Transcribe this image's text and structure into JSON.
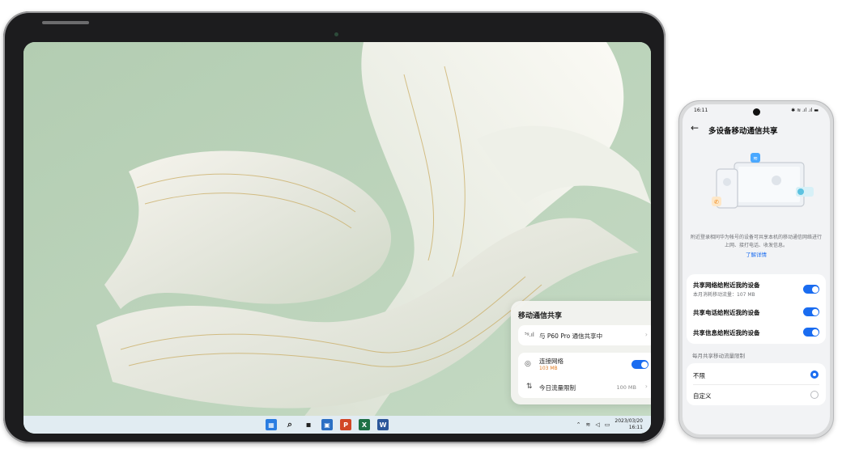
{
  "tablet": {
    "panel": {
      "title": "移动通信共享",
      "sharing_row": {
        "icon": "signal-icon",
        "label": "与 P60 Pro 通信共享中"
      },
      "connect_row": {
        "icon": "hotspot-icon",
        "label": "连接网络",
        "sub": "103 MB",
        "toggle_on": true
      },
      "limit_row": {
        "icon": "data-limit-icon",
        "label": "今日流量限制",
        "value": "100 MB"
      }
    },
    "taskbar": {
      "icons": [
        "windows-start-icon",
        "search-icon",
        "task-view-icon",
        "store-icon",
        "powerpoint-icon",
        "excel-icon",
        "word-icon"
      ],
      "tray_icons": [
        "chevron-up-icon",
        "wifi-icon",
        "volume-icon",
        "battery-icon"
      ],
      "date": "2023/03/20",
      "time": "16:11"
    }
  },
  "phone": {
    "status_time": "16:11",
    "title": "多设备移动通信共享",
    "description": "附近登录相同华为帐号的设备可共享本机的移动通信网络进行上网、接打电话、收发信息。",
    "link": "了解详情",
    "toggles": [
      {
        "label": "共享网络给附近我的设备",
        "sub": "本月消耗移动流量：107 MB",
        "on": true
      },
      {
        "label": "共享电话给附近我的设备",
        "on": true
      },
      {
        "label": "共享信息给附近我的设备",
        "on": true
      }
    ],
    "limit_section": "每月共享移动流量限制",
    "limit_options": [
      {
        "label": "不限",
        "selected": true
      },
      {
        "label": "自定义",
        "selected": false
      }
    ]
  },
  "colors": {
    "accent": "#1a6cf0",
    "orange": "#e07a1f",
    "wallpaper": "#b9d2b8"
  }
}
